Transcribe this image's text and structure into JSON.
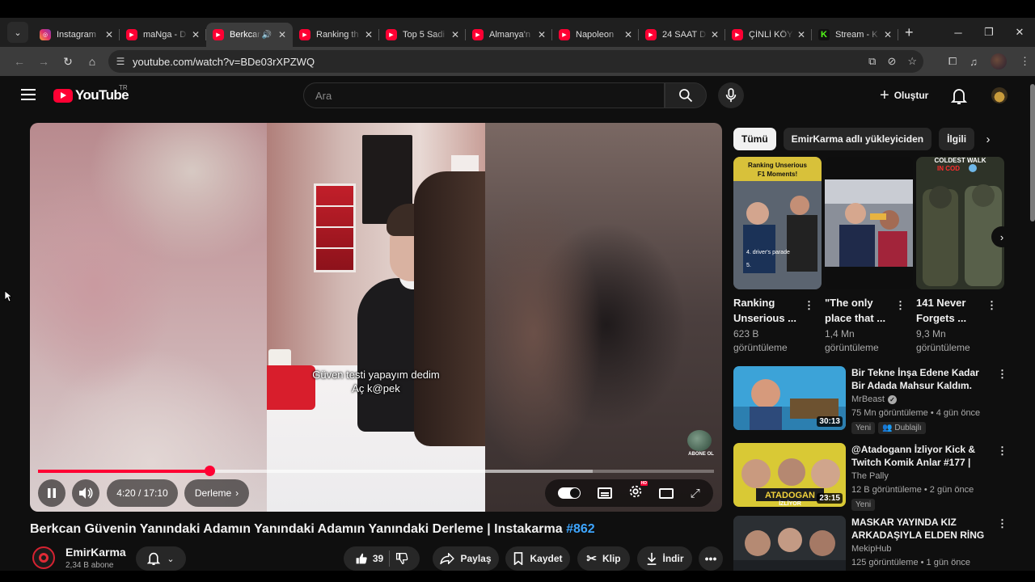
{
  "browser": {
    "tabs": [
      {
        "label": "Instagram",
        "icon": "instagram-icon"
      },
      {
        "label": "maNga - D",
        "icon": "youtube-icon"
      },
      {
        "label": "Berkcan",
        "icon": "youtube-icon",
        "active": true,
        "audio": true
      },
      {
        "label": "Ranking th",
        "icon": "youtube-icon"
      },
      {
        "label": "Top 5 Sadi",
        "icon": "youtube-icon"
      },
      {
        "label": "Almanya'n",
        "icon": "youtube-icon"
      },
      {
        "label": "Napoleon",
        "icon": "youtube-icon"
      },
      {
        "label": "24 SAAT D",
        "icon": "youtube-icon"
      },
      {
        "label": "ÇİNLİ KÖY",
        "icon": "youtube-icon"
      },
      {
        "label": "Stream - K",
        "icon": "kick-icon"
      }
    ],
    "url": "youtube.com/watch?v=BDe03rXPZWQ"
  },
  "masthead": {
    "logo_text": "YouTube",
    "country_code": "TR",
    "search_placeholder": "Ara",
    "create_label": "Oluştur"
  },
  "player": {
    "caption_line1": "Güven testi yapayım dedim",
    "caption_line2": "Aç k@pek",
    "watermark_text": "ABONE OL",
    "time_display": "4:20 / 17:10",
    "chapter_label": "Derleme",
    "progress_played": 0.2534,
    "progress_buffered": 0.82,
    "accent": "#ff0033"
  },
  "video": {
    "title": "Berkcan Güvenin Yanındaki Adamın Yanındaki Adamın Yanındaki Derleme | Instakarma",
    "hashtag": "#862",
    "channel_name": "EmirKarma",
    "subscribers": "2,34 B abone",
    "likes": "39",
    "share_label": "Paylaş",
    "save_label": "Kaydet",
    "clip_label": "Klip",
    "download_label": "İndir"
  },
  "sidebar": {
    "chips": [
      "Tümü",
      "EmirKarma adlı yükleyiciden",
      "İlgili"
    ],
    "shorts": [
      {
        "title_line1": "Ranking",
        "title_line2": "Unserious ...",
        "views_line1": "623 B",
        "views_line2": "görüntüleme",
        "thumb_text": "Ranking Unserious F1 Moments!"
      },
      {
        "title_line1": "\"The only",
        "title_line2": "place that ...",
        "views_line1": "1,4 Mn",
        "views_line2": "görüntüleme",
        "thumb_text": ""
      },
      {
        "title_line1": "141 Never",
        "title_line2": "Forgets ...",
        "views_line1": "9,3 Mn",
        "views_line2": "görüntüleme",
        "thumb_text": "COLDEST WALK IN COD"
      }
    ],
    "recommendations": [
      {
        "title": "Bir Tekne İnşa Edene Kadar Bir Adada Mahsur Kaldım.",
        "channel": "MrBeast",
        "verified": true,
        "views": "75 Mn görüntüleme • 4 gün önce",
        "duration": "30:13",
        "badges": [
          "Yeni",
          "Dublajlı"
        ]
      },
      {
        "title": "@Atadogann İzliyor Kick & Twitch Komik Anlar #177 | The...",
        "channel": "The Pally",
        "verified": false,
        "views": "12 B görüntüleme • 2 gün önce",
        "duration": "23:15",
        "badges": [
          "Yeni"
        ],
        "thumb_text": "ATADOGAN İZLİYOR"
      },
      {
        "title": "MASKAR YAYINDA KIZ ARKADAŞIYLA ELDEN RİNG ...",
        "channel": "MekipHub",
        "verified": false,
        "views": "125 görüntüleme • 1 gün önce",
        "duration": "",
        "badges": []
      }
    ]
  }
}
